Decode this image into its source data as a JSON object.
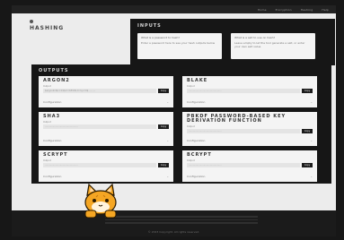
{
  "brand": {
    "title": "HASHING"
  },
  "nav": {
    "links": [
      "Home",
      "Encryption",
      "Hashing",
      "Help"
    ]
  },
  "inputs": {
    "title": "INPUTS",
    "fields": [
      {
        "label": "What is a password to hash?",
        "value": "Enter a password here to see your hash outputs below"
      },
      {
        "label": "What is a salt to use on hash?",
        "value": "Leave empty to let the tool generate a salt, or enter your own salt value"
      }
    ]
  },
  "outputs": {
    "title": "OUTPUTS",
    "cards": [
      {
        "title": "ARGON2",
        "sublabel": "Output",
        "value": "$argon2id$v=19$m=65536,t=3,p=4$..........",
        "copy": "Copy",
        "config": "Configuration"
      },
      {
        "title": "BLAKE",
        "sublabel": "Output",
        "value": "..............................................",
        "copy": "Copy",
        "config": "Configuration"
      },
      {
        "title": "SHA3",
        "sublabel": "Output",
        "value": "..............................................",
        "copy": "Copy",
        "config": "Configuration"
      },
      {
        "title": "PBKDF PASSWORD-BASED KEY DERIVATION FUNCTION",
        "sublabel": "Output",
        "value": "..............................................",
        "copy": "Copy",
        "config": "Configuration"
      },
      {
        "title": "SCRYPT",
        "sublabel": "Output",
        "value": "..............................................",
        "copy": "Copy",
        "config": "Configuration"
      },
      {
        "title": "BCRYPT",
        "sublabel": "Output",
        "value": "..............................................",
        "copy": "Copy",
        "config": "Configuration"
      }
    ]
  },
  "footer": {
    "copyright": "© 2023 Copyright. All rights reserved."
  },
  "colors": {
    "panel": "#161616",
    "page": "#ececec",
    "frame": "#f3ecb0",
    "cat": "#f5a623"
  },
  "icons": {
    "brand": "dot-icon",
    "mascot": "cat-mascot-icon",
    "dropdown": "chevron-down-icon"
  }
}
